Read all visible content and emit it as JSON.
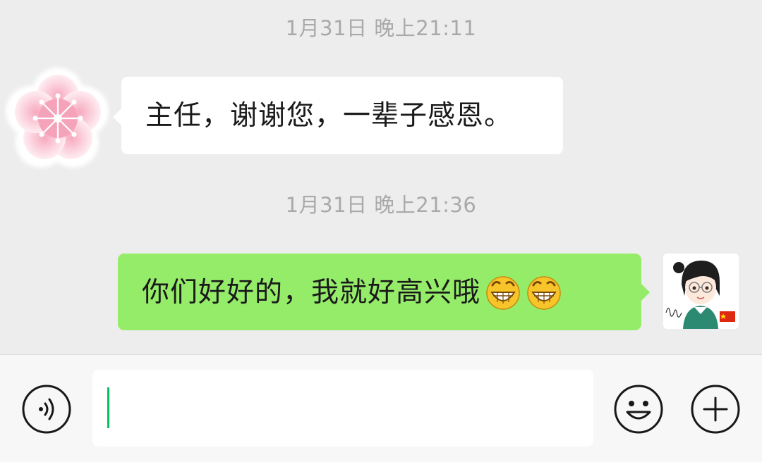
{
  "messages": [
    {
      "timestamp": "1月31日 晚上21:11",
      "sender": "left",
      "text": "主任，谢谢您，一辈子感恩。",
      "avatar": "cherry-blossom-avatar"
    },
    {
      "timestamp": "1月31日 晚上21:36",
      "sender": "right",
      "text": "你们好好的，我就好高兴哦",
      "emojis": [
        "grin-emoji",
        "grin-emoji"
      ],
      "avatar": "cartoon-girl-avatar"
    }
  ],
  "input_bar": {
    "voice_icon": "voice-icon",
    "emoji_icon": "smiley-icon",
    "plus_icon": "plus-icon",
    "input_value": ""
  },
  "colors": {
    "background": "#ededed",
    "received_bubble": "#ffffff",
    "sent_bubble": "#95ec69",
    "timestamp_text": "#a9a9a9",
    "cursor": "#07c160"
  }
}
